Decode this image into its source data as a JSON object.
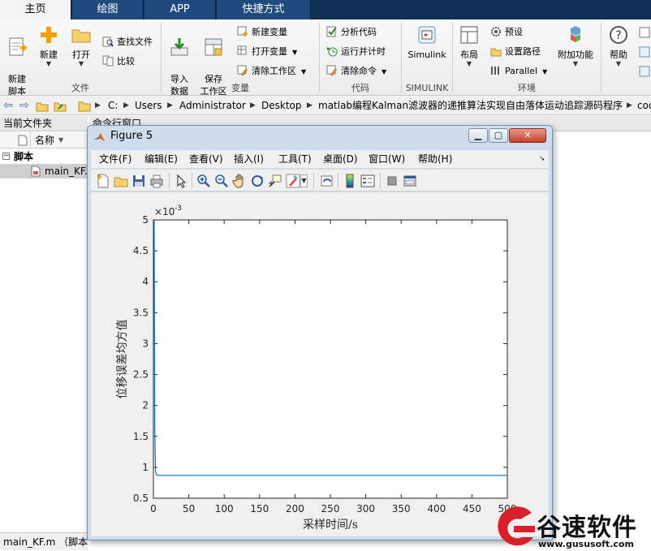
{
  "tabs": [
    {
      "label": "主页",
      "active": true
    },
    {
      "label": "绘图",
      "active": false
    },
    {
      "label": "APP",
      "active": false
    },
    {
      "label": "快捷方式",
      "active": false
    }
  ],
  "ribbon": {
    "file": {
      "new_script": "新建\n脚本",
      "new": "新建",
      "open": "打开",
      "find_files": "查找文件",
      "compare": "比较",
      "group_label": "文件"
    },
    "variable": {
      "import_data": "导入\n数据",
      "save_workspace": "保存\n工作区",
      "new_variable": "新建变量",
      "open_variable": "打开变量",
      "clear_workspace": "清除工作区",
      "group_label": "变量"
    },
    "code": {
      "analyze_code": "分析代码",
      "run_and_time": "运行并计时",
      "clear_commands": "清除命令",
      "group_label": "代码"
    },
    "simulink": {
      "simulink": "Simulink",
      "group_label": "SIMULINK"
    },
    "environment": {
      "layout": "布局",
      "preferences": "预设",
      "set_path": "设置路径",
      "parallel": "Parallel",
      "addons": "附加功能",
      "group_label": "环境"
    },
    "help": {
      "help": "帮助"
    }
  },
  "address": {
    "crumbs": [
      "C:",
      "Users",
      "Administrator",
      "Desktop",
      "matlab编程Kalman滤波器的递推算法实现自由落体运动追踪源码程序",
      "cod"
    ]
  },
  "current_folder": {
    "title": "当前文件夹",
    "column_name": "名称",
    "group": "脚本",
    "file": "main_KF.m",
    "status": "main_KF.m （脚本）"
  },
  "command_window": {
    "title": "命令行窗口"
  },
  "figure": {
    "title": "Figure 5",
    "menu": [
      "文件(F)",
      "编辑(E)",
      "查看(V)",
      "插入(I)",
      "工具(T)",
      "桌面(D)",
      "窗口(W)",
      "帮助(H)"
    ]
  },
  "chart_data": {
    "type": "line",
    "title": "",
    "xlabel": "采样时间/s",
    "ylabel": "位移误差均方值",
    "y_exponent_label": "×10",
    "y_exponent": "-3",
    "xlim": [
      0,
      500
    ],
    "ylim": [
      0.5,
      5
    ],
    "xticks": [
      0,
      50,
      100,
      150,
      200,
      250,
      300,
      350,
      400,
      450,
      500
    ],
    "yticks": [
      0.5,
      1,
      1.5,
      2,
      2.5,
      3,
      3.5,
      4,
      4.5,
      5
    ],
    "ytick_labels": [
      "0.5",
      "1",
      "1.5",
      "2",
      "2.5",
      "3",
      "3.5",
      "4",
      "4.5",
      "5"
    ],
    "series": [
      {
        "color": "#0072bd",
        "x": [
          1,
          2,
          3,
          5,
          10,
          20,
          50,
          100,
          200,
          300,
          400,
          500
        ],
        "y": [
          5.0,
          1.6,
          0.92,
          0.87,
          0.87,
          0.87,
          0.87,
          0.87,
          0.87,
          0.87,
          0.87,
          0.87
        ]
      }
    ]
  },
  "watermark": {
    "brand": "谷速软件",
    "url": "www.gususoft.com"
  },
  "colors": {
    "tabbar_bg": "#0f2f55",
    "tab_bg": "#1e4a7d",
    "line": "#0072bd",
    "watermark_red": "#d8202a"
  }
}
